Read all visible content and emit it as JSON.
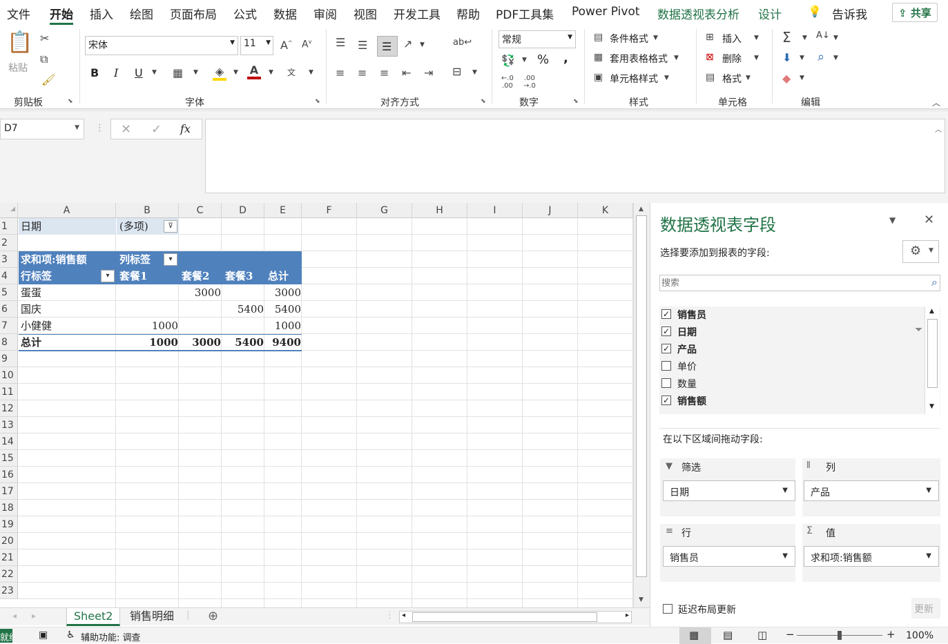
{
  "menu": {
    "file": "文件",
    "home": "开始",
    "insert": "插入",
    "draw": "绘图",
    "layout": "页面布局",
    "formulas": "公式",
    "data": "数据",
    "review": "审阅",
    "view": "视图",
    "developer": "开发工具",
    "help": "帮助",
    "pdf": "PDF工具集",
    "powerpivot": "Power Pivot",
    "pivot_analyze": "数据透视表分析",
    "design": "设计",
    "tell_me": "告诉我",
    "share": "共享"
  },
  "ribbon": {
    "clipboard": {
      "label": "剪贴板",
      "paste": "粘贴"
    },
    "font": {
      "label": "字体",
      "name": "宋体",
      "size": "11",
      "bold": "B",
      "italic": "I",
      "underline": "U"
    },
    "alignment": {
      "label": "对齐方式"
    },
    "number": {
      "label": "数字",
      "format": "常规",
      "percent": "%",
      "comma": ","
    },
    "styles": {
      "label": "样式",
      "conditional": "条件格式",
      "table": "套用表格格式",
      "cell": "单元格样式"
    },
    "cells": {
      "label": "单元格",
      "insert": "插入",
      "delete": "删除",
      "format": "格式"
    },
    "editing": {
      "label": "编辑"
    }
  },
  "formula_bar": {
    "name_box": "D7",
    "fx": "fx",
    "value": ""
  },
  "columns": [
    "A",
    "B",
    "C",
    "D",
    "E",
    "F",
    "G",
    "H",
    "I",
    "J",
    "K"
  ],
  "rows": [
    "1",
    "2",
    "3",
    "4",
    "5",
    "6",
    "7",
    "8",
    "9",
    "10",
    "11",
    "12",
    "13",
    "14",
    "15",
    "16",
    "17",
    "18",
    "19",
    "20",
    "21",
    "22",
    "23"
  ],
  "pivot": {
    "filter_label": "日期",
    "filter_value": "(多项)",
    "value_header": "求和项:销售额",
    "col_label_header": "列标签",
    "row_label_header": "行标签",
    "col_headers": [
      "套餐1",
      "套餐2",
      "套餐3",
      "总计"
    ],
    "rows": [
      {
        "label": "蛋蛋",
        "values": [
          "",
          "3000",
          "",
          "3000"
        ]
      },
      {
        "label": "国庆",
        "values": [
          "",
          "",
          "5400",
          "5400"
        ]
      },
      {
        "label": "小健健",
        "values": [
          "1000",
          "",
          "",
          "1000"
        ]
      }
    ],
    "total": {
      "label": "总计",
      "values": [
        "1000",
        "3000",
        "5400",
        "9400"
      ]
    }
  },
  "sheet_tabs": {
    "active": "Sheet2",
    "other": "销售明细"
  },
  "status": {
    "ready": "就绪",
    "accessibility": "辅助功能: 调查",
    "zoom": "100%"
  },
  "field_panel": {
    "title": "数据透视表字段",
    "subtitle": "选择要添加到报表的字段:",
    "search_placeholder": "搜索",
    "fields": [
      {
        "name": "销售员",
        "checked": true,
        "bold": true
      },
      {
        "name": "日期",
        "checked": true,
        "bold": true
      },
      {
        "name": "产品",
        "checked": true,
        "bold": true
      },
      {
        "name": "单价",
        "checked": false,
        "bold": false
      },
      {
        "name": "数量",
        "checked": false,
        "bold": false
      },
      {
        "name": "销售额",
        "checked": true,
        "bold": true
      }
    ],
    "drag_label": "在以下区域间拖动字段:",
    "filters_label": "筛选",
    "filters_value": "日期",
    "columns_label": "列",
    "columns_value": "产品",
    "rows_label": "行",
    "rows_value": "销售员",
    "values_label": "值",
    "values_value": "求和项:销售额",
    "defer_label": "延迟布局更新",
    "update_label": "更新"
  }
}
